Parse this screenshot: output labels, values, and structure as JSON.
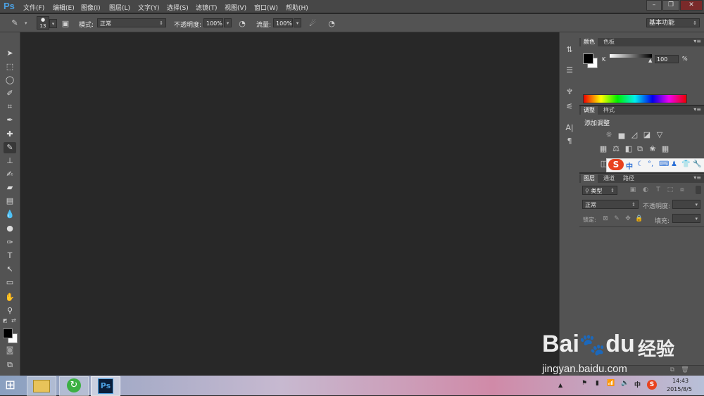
{
  "menubar": {
    "logo": "Ps",
    "items": [
      "文件(F)",
      "编辑(E)",
      "图像(I)",
      "图层(L)",
      "文字(Y)",
      "选择(S)",
      "滤镜(T)",
      "视图(V)",
      "窗口(W)",
      "帮助(H)"
    ]
  },
  "options": {
    "brush_size": "13",
    "mode_label": "模式:",
    "mode_value": "正常",
    "opacity_label": "不透明度:",
    "opacity_value": "100%",
    "flow_label": "流量:",
    "flow_value": "100%",
    "workspace": "基本功能"
  },
  "color_panel": {
    "tabs": [
      "颜色",
      "色板"
    ],
    "channel": "K",
    "value": "100",
    "unit": "%"
  },
  "adjust_panel": {
    "tabs": [
      "调整",
      "样式"
    ],
    "title": "添加调整"
  },
  "ime_bar": {
    "logo": "S",
    "lang": "中"
  },
  "layers_panel": {
    "tabs": [
      "图层",
      "通道",
      "路径"
    ],
    "filter": "类型",
    "blend": "正常",
    "opacity_label": "不透明度:",
    "lock_label": "锁定:",
    "fill_label": "填充:"
  },
  "watermark": {
    "brand": "Bai",
    "brand2": "du",
    "cn": "经验",
    "url": "jingyan.baidu.com"
  },
  "taskbar": {
    "ps_label": "Ps",
    "ime": "中",
    "time": "14:43",
    "date": "2015/8/5"
  }
}
